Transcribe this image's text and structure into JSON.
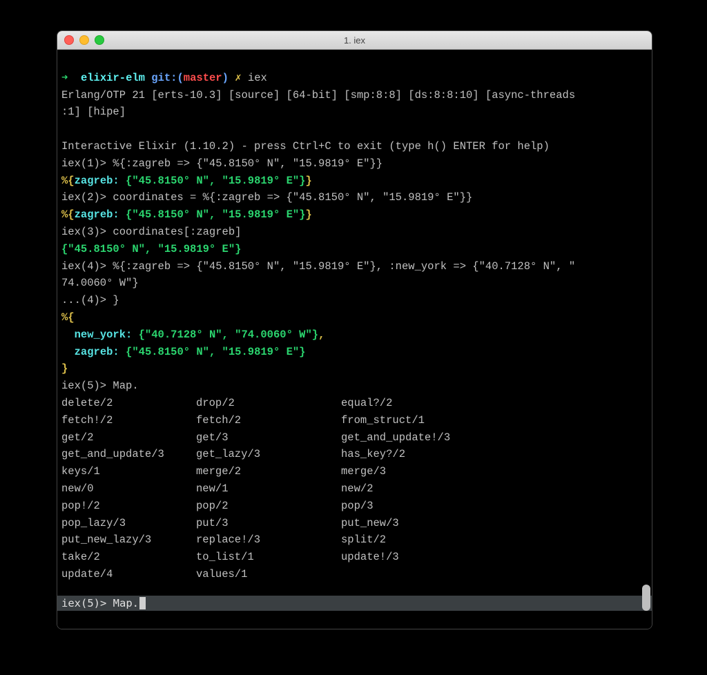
{
  "window": {
    "title": "1. iex"
  },
  "prompt": {
    "arrow": "➜",
    "dir": "elixir-elm",
    "git_label": "git:(",
    "branch": "master",
    "git_close": ")",
    "dirty": "✗",
    "cmd": "iex"
  },
  "banner": {
    "line1": "Erlang/OTP 21 [erts-10.3] [source] [64-bit] [smp:8:8] [ds:8:8:10] [async-threads",
    "line2": ":1] [hipe]",
    "blank": "",
    "intro": "Interactive Elixir (1.10.2) - press Ctrl+C to exit (type h() ENTER for help)"
  },
  "lines": {
    "iex1": "iex(1)> %{:zagreb => {\"45.8150° N\", \"15.9819° E\"}}",
    "out1_open": "%{",
    "out1_key": "zagreb:",
    "out1_val": " {\"45.8150° N\", \"15.9819° E\"}",
    "out1_close": "}",
    "iex2": "iex(2)> coordinates = %{:zagreb => {\"45.8150° N\", \"15.9819° E\"}}",
    "iex3": "iex(3)> coordinates[:zagreb]",
    "out3": "{\"45.8150° N\", \"15.9819° E\"}",
    "iex4a": "iex(4)> %{:zagreb => {\"45.8150° N\", \"15.9819° E\"}, :new_york => {\"40.7128° N\", \"",
    "iex4b": "74.0060° W\"}",
    "iex4c": "...(4)> }",
    "mopen": "%{",
    "m_ny_pad": "  ",
    "m_ny_key": "new_york:",
    "m_ny_val": " {\"40.7128° N\", \"74.0060° W\"}",
    "m_ny_comma": ",",
    "m_za_pad": "  ",
    "m_za_key": "zagreb:",
    "m_za_val": " {\"45.8150° N\", \"15.9819° E\"}",
    "mclose": "}",
    "iex5": "iex(5)> Map."
  },
  "completions": [
    [
      "delete/2",
      "drop/2",
      "equal?/2"
    ],
    [
      "fetch!/2",
      "fetch/2",
      "from_struct/1"
    ],
    [
      "get/2",
      "get/3",
      "get_and_update!/3"
    ],
    [
      "get_and_update/3",
      "get_lazy/3",
      "has_key?/2"
    ],
    [
      "keys/1",
      "merge/2",
      "merge/3"
    ],
    [
      "new/0",
      "new/1",
      "new/2"
    ],
    [
      "pop!/2",
      "pop/2",
      "pop/3"
    ],
    [
      "pop_lazy/3",
      "put/3",
      "put_new/3"
    ],
    [
      "put_new_lazy/3",
      "replace!/3",
      "split/2"
    ],
    [
      "take/2",
      "to_list/1",
      "update!/3"
    ],
    [
      "update/4",
      "values/1",
      ""
    ]
  ],
  "active_prompt": "iex(5)> Map."
}
